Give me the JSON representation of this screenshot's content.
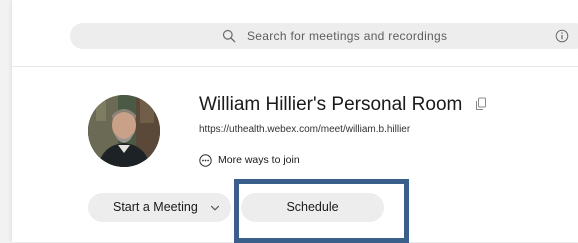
{
  "search": {
    "placeholder": "Search for meetings and recordings",
    "icon": "search-icon",
    "info_icon": "info-icon"
  },
  "room": {
    "title": "William Hillier's Personal Room",
    "link": "https://uthealth.webex.com/meet/william.b.hillier",
    "more_ways_label": "More ways to join"
  },
  "actions": {
    "start_label": "Start a Meeting",
    "schedule_label": "Schedule"
  },
  "colors": {
    "highlight_border": "#3a5f8a",
    "pill_background": "#ededed"
  }
}
